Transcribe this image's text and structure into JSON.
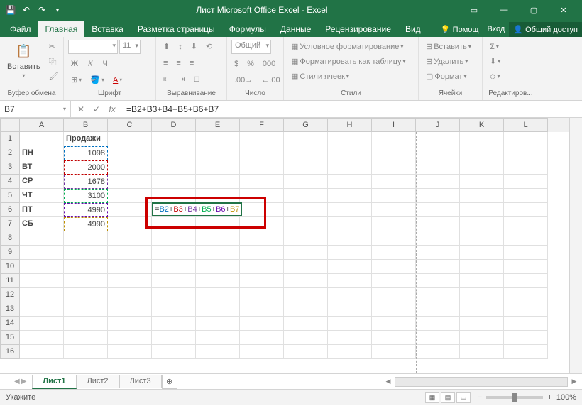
{
  "title": "Лист Microsoft Office Excel - Excel",
  "tabs": {
    "file": "Файл",
    "home": "Главная",
    "insert": "Вставка",
    "layout": "Разметка страницы",
    "formulas": "Формулы",
    "data": "Данные",
    "review": "Рецензирование",
    "view": "Вид",
    "help": "Помощ",
    "login": "Вход",
    "share": "Общий доступ"
  },
  "ribbon": {
    "clipboard": {
      "label": "Буфер обмена",
      "paste": "Вставить"
    },
    "font": {
      "label": "Шрифт",
      "size": "11",
      "bold": "Ж",
      "italic": "К",
      "underline": "Ч"
    },
    "align": {
      "label": "Выравнивание"
    },
    "number": {
      "label": "Число",
      "format": "Общий"
    },
    "styles": {
      "label": "Стили",
      "cond": "Условное форматирование",
      "table": "Форматировать как таблицу",
      "cell": "Стили ячеек"
    },
    "cells": {
      "label": "Ячейки",
      "insert": "Вставить",
      "delete": "Удалить",
      "format": "Формат"
    },
    "editing": {
      "label": "Редактиров..."
    }
  },
  "namebox": "B7",
  "formula": "=B2+B3+B4+B5+B6+B7",
  "columns": [
    "A",
    "B",
    "C",
    "D",
    "E",
    "F",
    "G",
    "H",
    "I",
    "J",
    "K",
    "L"
  ],
  "data_rows": [
    {
      "a": "",
      "b": "Продажи",
      "bold_b": true,
      "bold_a": false
    },
    {
      "a": "ПН",
      "b": "1098"
    },
    {
      "a": "ВТ",
      "b": "2000"
    },
    {
      "a": "СР",
      "b": "1678"
    },
    {
      "a": "ЧТ",
      "b": "3100"
    },
    {
      "a": "ПТ",
      "b": "4990"
    },
    {
      "a": "СБ",
      "b": "4990"
    }
  ],
  "formula_cell": {
    "prefix": "=",
    "refs": [
      "B2",
      "B3",
      "B4",
      "B5",
      "B6",
      "B7"
    ],
    "colors": [
      "#0070c0",
      "#c00000",
      "#7030a0",
      "#00b050",
      "#6a0dad",
      "#bf9000"
    ]
  },
  "sheets": {
    "s1": "Лист1",
    "s2": "Лист2",
    "s3": "Лист3"
  },
  "status": {
    "mode": "Укажите",
    "zoom": "100%"
  },
  "chart_data": {
    "type": "table",
    "title": "Продажи",
    "categories": [
      "ПН",
      "ВТ",
      "СР",
      "ЧТ",
      "ПТ",
      "СБ"
    ],
    "values": [
      1098,
      2000,
      1678,
      3100,
      4990,
      4990
    ]
  }
}
